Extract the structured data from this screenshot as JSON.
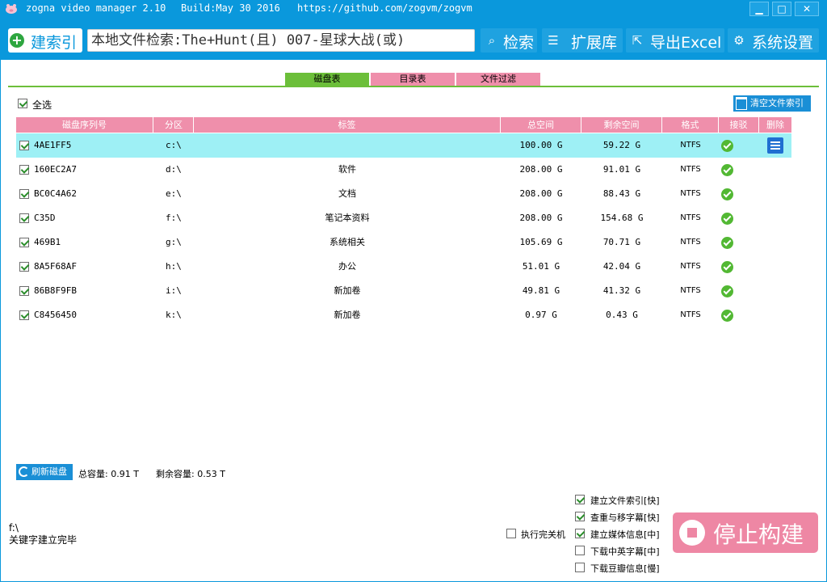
{
  "titlebar": {
    "app_name": "zogna video manager 2.10",
    "build": "Build:May 30 2016",
    "url": "https://github.com/zogvm/zogvm",
    "min": "▁",
    "max": "□",
    "close": "✕"
  },
  "toolbar": {
    "index_label": "建索引",
    "search_value": "本地文件检索:The+Hunt(且) 007-星球大战(或)",
    "search_label": "检索",
    "ext_label": "扩展库",
    "excel_label": "导出Excel",
    "settings_label": "系统设置"
  },
  "tabs": [
    {
      "label": "磁盘表",
      "active": true
    },
    {
      "label": "目录表",
      "active": false
    },
    {
      "label": "文件过滤",
      "active": false
    }
  ],
  "select_all_label": "全选",
  "clear_index_label": "清空文件索引",
  "table": {
    "headers": [
      "磁盘序列号",
      "分区",
      "标签",
      "总空间",
      "剩余空间",
      "格式",
      "接驳",
      "删除"
    ],
    "rows": [
      {
        "serial": "4AE1FF5",
        "partition": "c:\\",
        "tag": "",
        "total": "100.00 G",
        "free": "59.22 G",
        "format": "NTFS",
        "selected": true
      },
      {
        "serial": "160EC2A7",
        "partition": "d:\\",
        "tag": "软件",
        "total": "208.00 G",
        "free": "91.01 G",
        "format": "NTFS",
        "selected": false
      },
      {
        "serial": "BC0C4A62",
        "partition": "e:\\",
        "tag": "文档",
        "total": "208.00 G",
        "free": "88.43 G",
        "format": "NTFS",
        "selected": false
      },
      {
        "serial": "C35D",
        "partition": "f:\\",
        "tag": "笔记本资料",
        "total": "208.00 G",
        "free": "154.68 G",
        "format": "NTFS",
        "selected": false
      },
      {
        "serial": "469B1",
        "partition": "g:\\",
        "tag": "系统相关",
        "total": "105.69 G",
        "free": "70.71 G",
        "format": "NTFS",
        "selected": false
      },
      {
        "serial": "8A5F68AF",
        "partition": "h:\\",
        "tag": "办公",
        "total": "51.01 G",
        "free": "42.04 G",
        "format": "NTFS",
        "selected": false
      },
      {
        "serial": "86B8F9FB",
        "partition": "i:\\",
        "tag": "新加卷",
        "total": "49.81 G",
        "free": "41.32 G",
        "format": "NTFS",
        "selected": false
      },
      {
        "serial": "C8456450",
        "partition": "k:\\",
        "tag": "新加卷",
        "total": "0.97 G",
        "free": "0.43 G",
        "format": "NTFS",
        "selected": false
      }
    ]
  },
  "footer": {
    "refresh_label": "刷新磁盘",
    "total_capacity": "总容量: 0.91 T",
    "free_capacity": "剩余容量: 0.53 T",
    "status_path": "f:\\",
    "status_msg": "关键字建立完毕",
    "shutdown_label": "执行完关机",
    "options": [
      {
        "label": "建立文件索引[快]",
        "checked": true
      },
      {
        "label": "查重与移字幕[快]",
        "checked": true
      },
      {
        "label": "建立媒体信息[中]",
        "checked": true
      },
      {
        "label": "下载中英字幕[中]",
        "checked": false
      },
      {
        "label": "下载豆瓣信息[慢]",
        "checked": false
      }
    ],
    "stop_label": "停止构建"
  },
  "colors": {
    "primary": "#0a98dc",
    "pink": "#ef8fab",
    "green": "#6cbf3a",
    "selected_row": "#9ef0f5"
  }
}
